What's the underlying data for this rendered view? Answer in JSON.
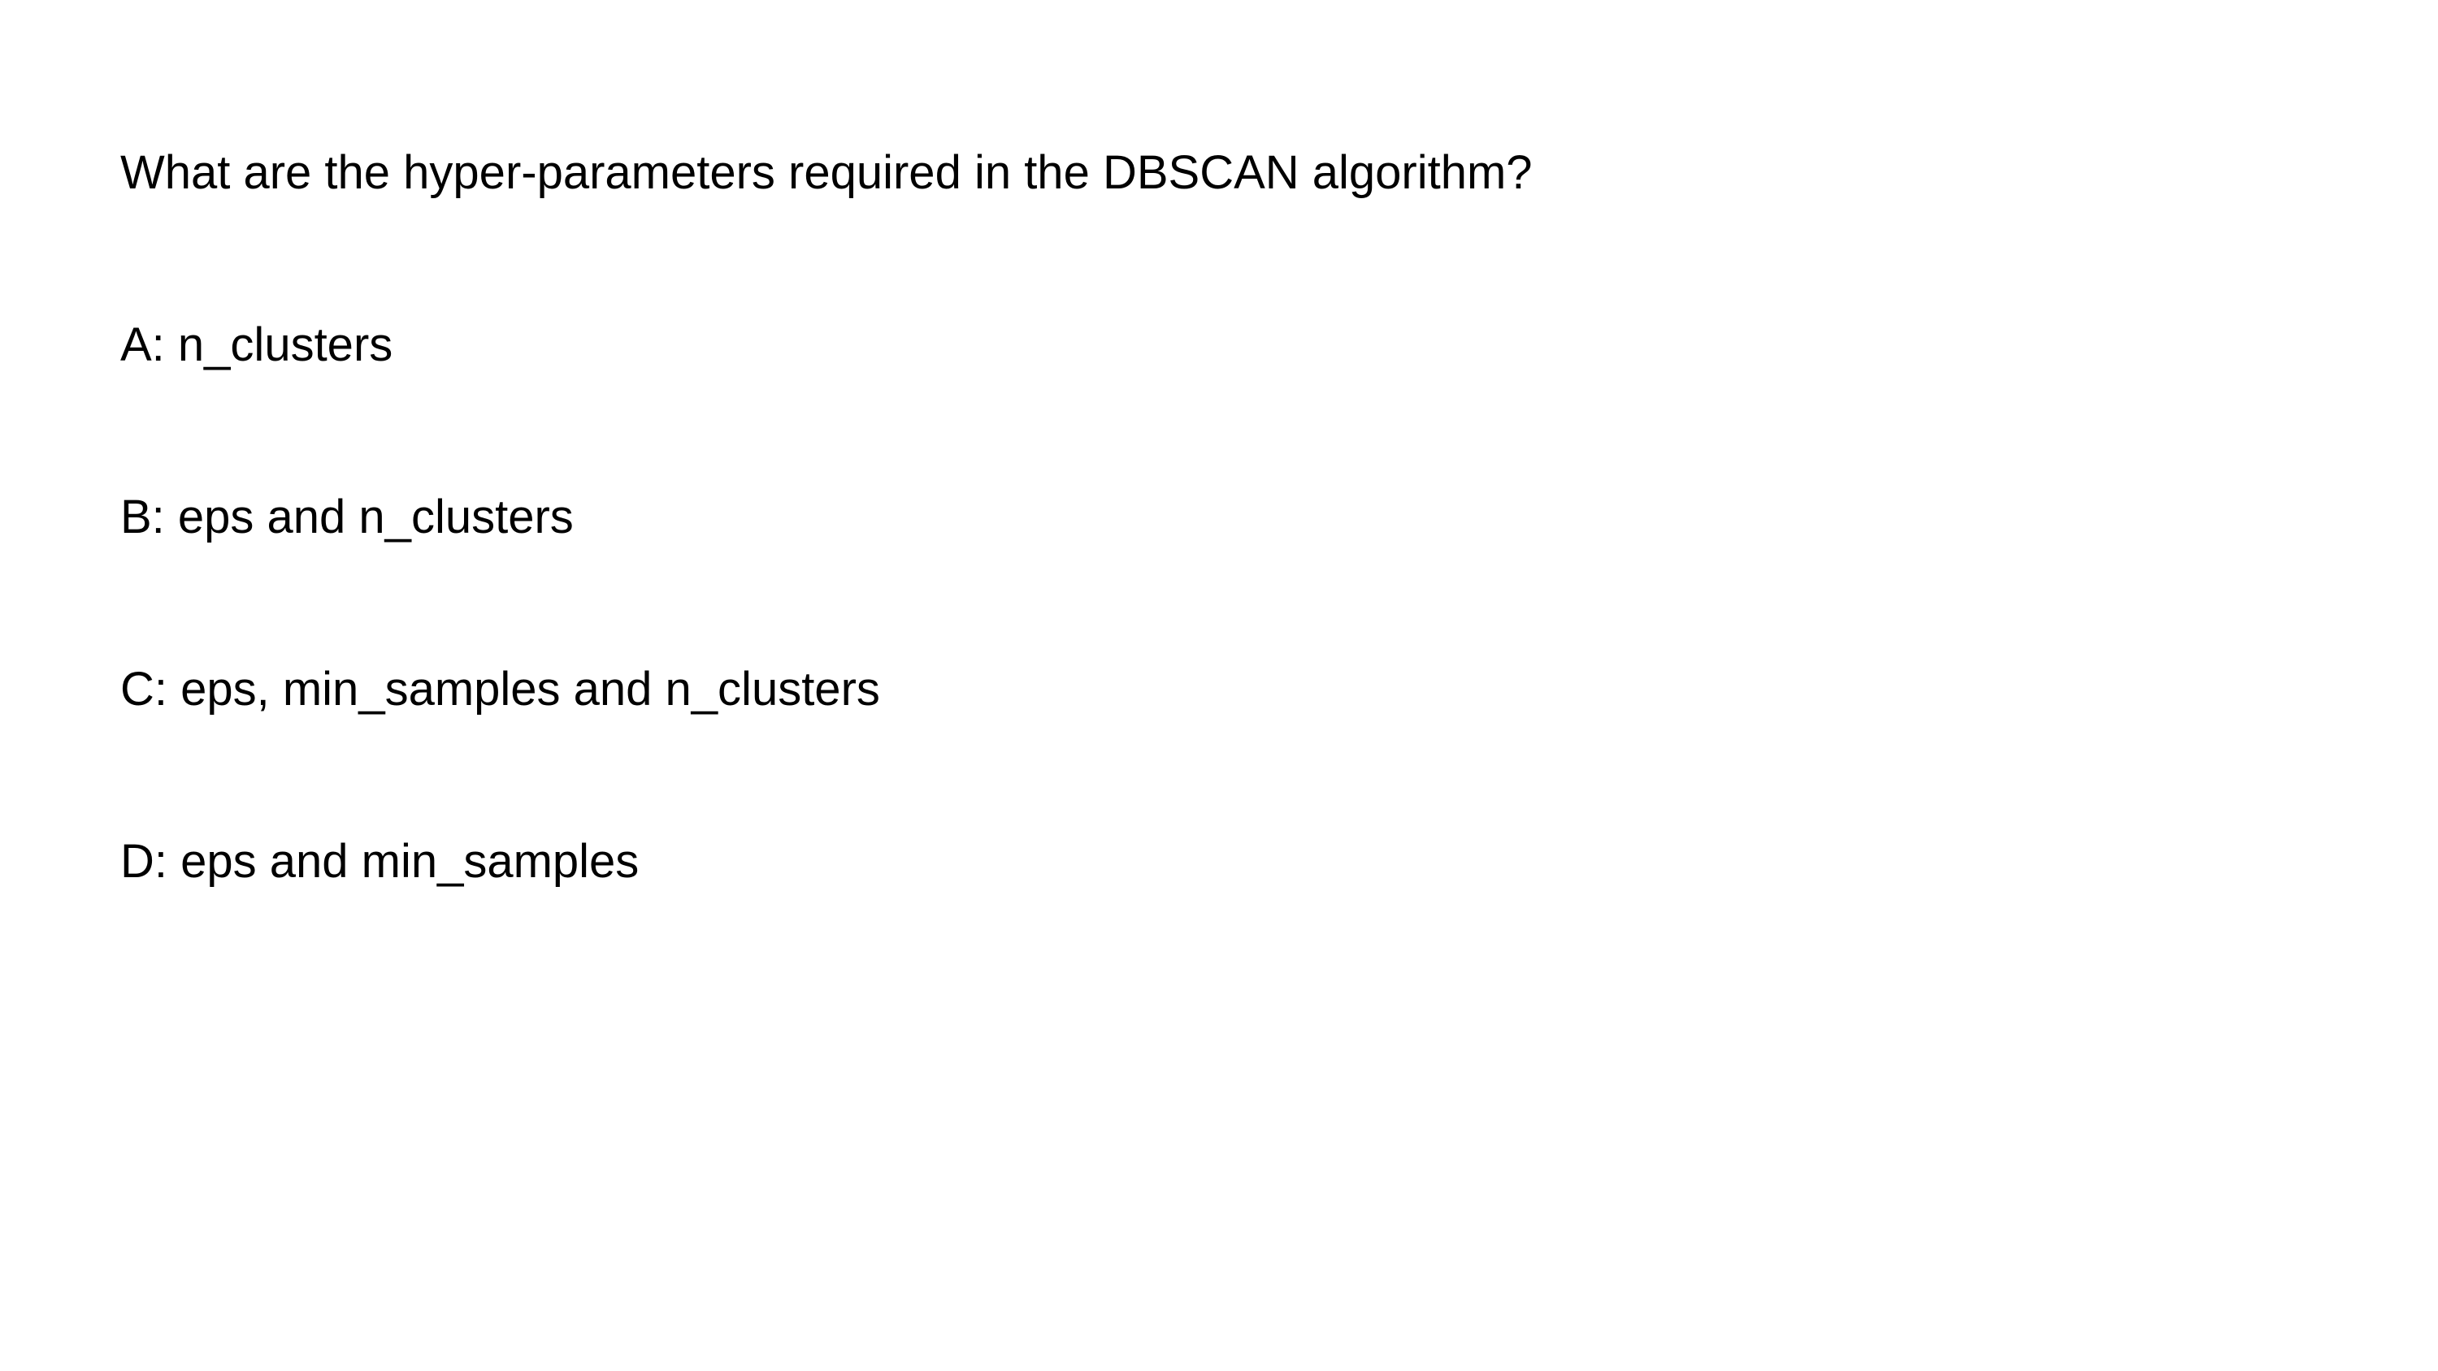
{
  "question": "What are the hyper-parameters required in the DBSCAN algorithm?",
  "options": [
    {
      "text": "A: n_clusters"
    },
    {
      "text": "B: eps and n_clusters"
    },
    {
      "text": "C: eps, min_samples and n_clusters"
    },
    {
      "text": "D: eps and min_samples"
    }
  ]
}
